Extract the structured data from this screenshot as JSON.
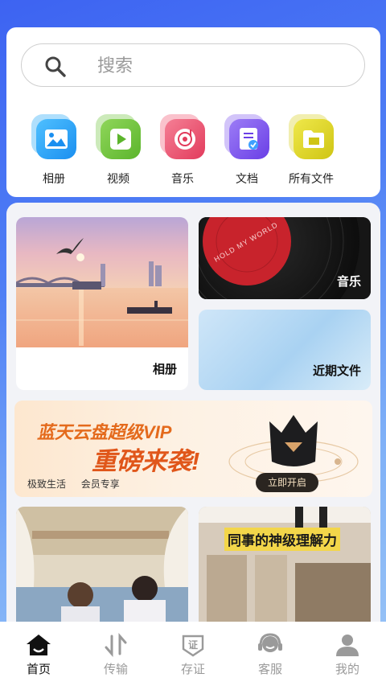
{
  "search": {
    "placeholder": "搜索"
  },
  "categories": [
    {
      "label": "相册",
      "icon": "photo-album-icon",
      "color": "#1aa3f5"
    },
    {
      "label": "视频",
      "icon": "video-play-icon",
      "color": "#6ec43a"
    },
    {
      "label": "音乐",
      "icon": "music-disc-icon",
      "color": "#f0506e"
    },
    {
      "label": "文档",
      "icon": "document-icon",
      "color": "#7d56ee"
    },
    {
      "label": "所有文件",
      "icon": "folder-icon",
      "color": "#d7cf1e"
    }
  ],
  "tiles": {
    "album": {
      "label": "相册"
    },
    "music": {
      "label": "音乐",
      "record_text": "HOLD MY WORLD"
    },
    "recent": {
      "label": "近期文件"
    }
  },
  "banner": {
    "title_line1": "蓝天云盘超级VIP",
    "title_line2": "重磅来袭!",
    "tagline_left": "极致生活",
    "tagline_right": "会员专享",
    "button": "立即开启"
  },
  "feed": {
    "right_caption": "同事的神级理解力"
  },
  "tabbar": [
    {
      "label": "首页",
      "icon": "home-icon",
      "active": true
    },
    {
      "label": "传输",
      "icon": "transfer-icon",
      "active": false
    },
    {
      "label": "存证",
      "icon": "certificate-icon",
      "active": false
    },
    {
      "label": "客服",
      "icon": "customer-service-icon",
      "active": false
    },
    {
      "label": "我的",
      "icon": "profile-icon",
      "active": false
    }
  ]
}
